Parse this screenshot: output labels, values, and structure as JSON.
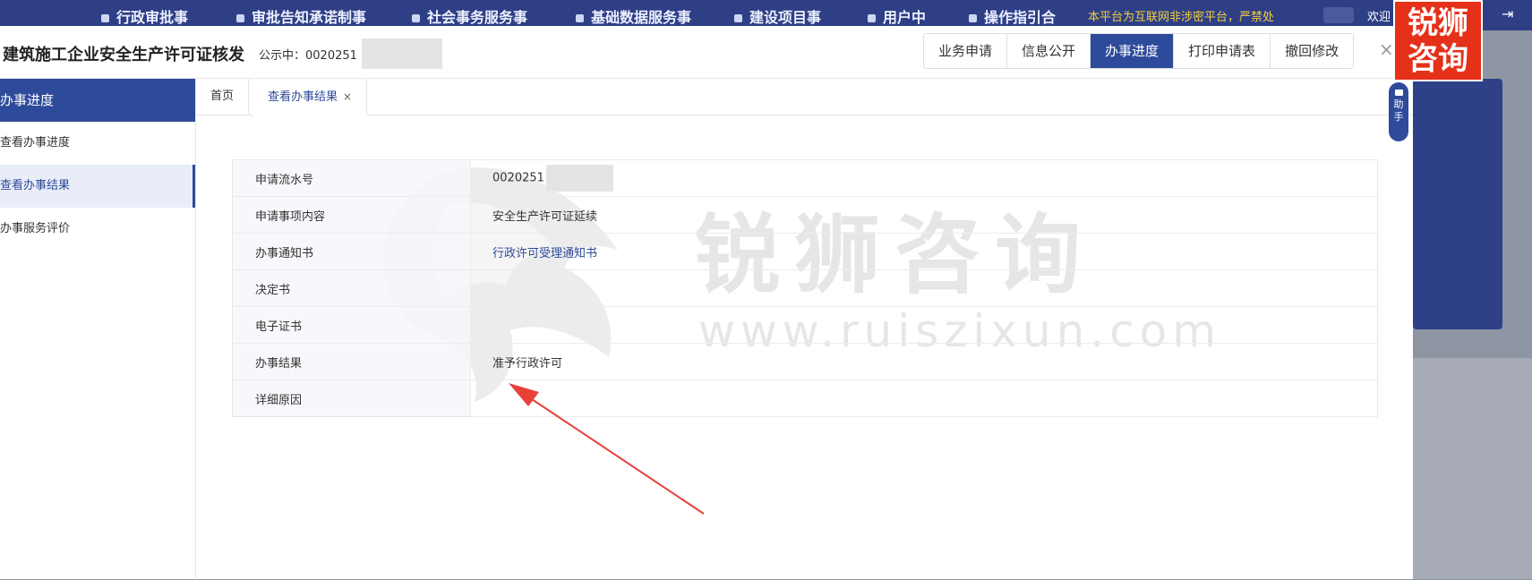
{
  "topnav": {
    "items": [
      {
        "label": "行政审批事"
      },
      {
        "label": "审批告知承诺制事"
      },
      {
        "label": "社会事务服务事"
      },
      {
        "label": "基础数据服务事"
      },
      {
        "label": "建设项目事"
      },
      {
        "label": "用户中"
      },
      {
        "label": "操作指引合"
      }
    ],
    "notice": "本平台为互联网非涉密平台，严禁处",
    "welcome": "欢迎",
    "logout_icon": "logout-icon"
  },
  "modal": {
    "title": "建筑施工企业安全生产许可证核发",
    "public_label": "公示中：0020251",
    "buttons": [
      {
        "label": "业务申请"
      },
      {
        "label": "信息公开"
      },
      {
        "label": "办事进度"
      },
      {
        "label": "打印申请表"
      },
      {
        "label": "撤回修改"
      }
    ],
    "close": "×"
  },
  "sidebar": {
    "header": "办事进度",
    "items": [
      {
        "label": "查看办事进度"
      },
      {
        "label": "查看办事结果"
      },
      {
        "label": "办事服务评价"
      }
    ]
  },
  "tabs": {
    "home": "首页",
    "current": "查看办事结果",
    "close": "×"
  },
  "table": {
    "rows": [
      {
        "label": "申请流水号",
        "value": "0020251"
      },
      {
        "label": "申请事项内容",
        "value": "安全生产许可证延续"
      },
      {
        "label": "办事通知书",
        "value": "行政许可受理通知书"
      },
      {
        "label": "决定书",
        "value": ""
      },
      {
        "label": "电子证书",
        "value": ""
      },
      {
        "label": "办事结果",
        "value": "准予行政许可"
      },
      {
        "label": "详细原因",
        "value": ""
      }
    ]
  },
  "helper": {
    "label_1": "助",
    "label_2": "手"
  },
  "brand": {
    "line1": "锐狮",
    "line2": "咨询"
  },
  "watermark": {
    "text": "锐狮咨询",
    "url": "www.ruiszixun.com"
  },
  "colors": {
    "primary": "#2e4a9a",
    "nav": "#2e3f86",
    "brand": "#e5301a",
    "arrow": "#e8413a"
  }
}
